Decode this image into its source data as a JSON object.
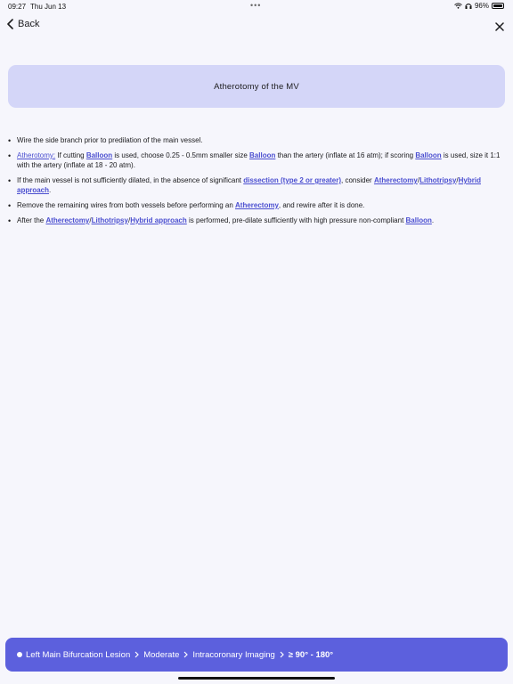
{
  "status_bar": {
    "time": "09:27",
    "date": "Thu Jun 13",
    "battery": "96%",
    "icons": [
      "wifi-icon",
      "headphones-icon",
      "battery-icon"
    ]
  },
  "nav": {
    "back_label": "Back",
    "back_icon": "chevron-left-icon",
    "close_icon": "close-icon"
  },
  "title": "Atherotomy of the MV",
  "bullets": {
    "b1": {
      "text": "Wire the side branch prior to predilation of the main vessel."
    },
    "b2": {
      "link_atherotomy": "Atherotomy:",
      "t1": " If cutting ",
      "link_balloon1": "Balloon",
      "t2": " is used, choose 0.25 - 0.5mm smaller size ",
      "link_balloon2": "Balloon",
      "t3": " than the artery (inflate at 16 atm); if scoring ",
      "link_balloon3": "Balloon",
      "t4": " is used, size it 1:1 with the artery (inflate at 18 - 20 atm)."
    },
    "b3": {
      "t1": "If the main vessel is not sufficiently dilated, in the absence of significant ",
      "link_dissection": "dissection (type 2 or greater)",
      "t2": ", consider ",
      "link_atherectomy": "Atherectomy",
      "sep1": "/",
      "link_lithotripsy": "Lithotripsy",
      "sep2": "/",
      "link_hybrid": "Hybrid approach",
      "t3": "."
    },
    "b4": {
      "t1": "Remove the remaining wires from both vessels before performing an ",
      "link_atherectomy": "Atherectomy",
      "t2": ", and rewire after it is done."
    },
    "b5": {
      "t1": "After the ",
      "link_atherectomy": "Atherectomy",
      "sep1": "/",
      "link_lithotripsy": "Lithotripsy",
      "sep2": "/",
      "link_hybrid": "Hybrid approach",
      "t2": " is performed, pre-dilate sufficiently with high pressure non-compliant ",
      "link_balloon": "Balloon",
      "t3": "."
    }
  },
  "breadcrumb": {
    "items": [
      "Left Main Bifurcation Lesion",
      "Moderate",
      "Intracoronary Imaging",
      "≥ 90° - 180°"
    ],
    "separator_icon": "chevron-right-icon"
  },
  "colors": {
    "accent": "#5c60dd",
    "title_card": "#d4d6f8",
    "link": "#4b4fd0",
    "background": "#f6f6fc"
  }
}
